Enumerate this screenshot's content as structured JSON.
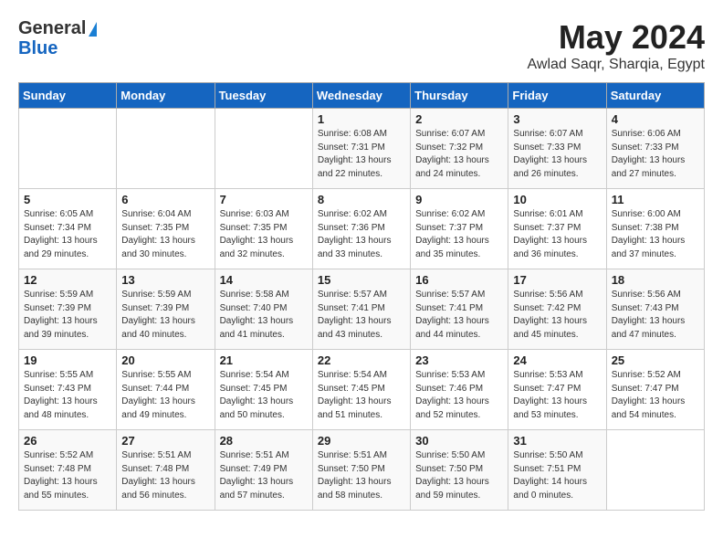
{
  "header": {
    "logo_line1": "General",
    "logo_line2": "Blue",
    "month": "May 2024",
    "location": "Awlad Saqr, Sharqia, Egypt"
  },
  "weekdays": [
    "Sunday",
    "Monday",
    "Tuesday",
    "Wednesday",
    "Thursday",
    "Friday",
    "Saturday"
  ],
  "weeks": [
    [
      {
        "day": "",
        "content": ""
      },
      {
        "day": "",
        "content": ""
      },
      {
        "day": "",
        "content": ""
      },
      {
        "day": "1",
        "content": "Sunrise: 6:08 AM\nSunset: 7:31 PM\nDaylight: 13 hours\nand 22 minutes."
      },
      {
        "day": "2",
        "content": "Sunrise: 6:07 AM\nSunset: 7:32 PM\nDaylight: 13 hours\nand 24 minutes."
      },
      {
        "day": "3",
        "content": "Sunrise: 6:07 AM\nSunset: 7:33 PM\nDaylight: 13 hours\nand 26 minutes."
      },
      {
        "day": "4",
        "content": "Sunrise: 6:06 AM\nSunset: 7:33 PM\nDaylight: 13 hours\nand 27 minutes."
      }
    ],
    [
      {
        "day": "5",
        "content": "Sunrise: 6:05 AM\nSunset: 7:34 PM\nDaylight: 13 hours\nand 29 minutes."
      },
      {
        "day": "6",
        "content": "Sunrise: 6:04 AM\nSunset: 7:35 PM\nDaylight: 13 hours\nand 30 minutes."
      },
      {
        "day": "7",
        "content": "Sunrise: 6:03 AM\nSunset: 7:35 PM\nDaylight: 13 hours\nand 32 minutes."
      },
      {
        "day": "8",
        "content": "Sunrise: 6:02 AM\nSunset: 7:36 PM\nDaylight: 13 hours\nand 33 minutes."
      },
      {
        "day": "9",
        "content": "Sunrise: 6:02 AM\nSunset: 7:37 PM\nDaylight: 13 hours\nand 35 minutes."
      },
      {
        "day": "10",
        "content": "Sunrise: 6:01 AM\nSunset: 7:37 PM\nDaylight: 13 hours\nand 36 minutes."
      },
      {
        "day": "11",
        "content": "Sunrise: 6:00 AM\nSunset: 7:38 PM\nDaylight: 13 hours\nand 37 minutes."
      }
    ],
    [
      {
        "day": "12",
        "content": "Sunrise: 5:59 AM\nSunset: 7:39 PM\nDaylight: 13 hours\nand 39 minutes."
      },
      {
        "day": "13",
        "content": "Sunrise: 5:59 AM\nSunset: 7:39 PM\nDaylight: 13 hours\nand 40 minutes."
      },
      {
        "day": "14",
        "content": "Sunrise: 5:58 AM\nSunset: 7:40 PM\nDaylight: 13 hours\nand 41 minutes."
      },
      {
        "day": "15",
        "content": "Sunrise: 5:57 AM\nSunset: 7:41 PM\nDaylight: 13 hours\nand 43 minutes."
      },
      {
        "day": "16",
        "content": "Sunrise: 5:57 AM\nSunset: 7:41 PM\nDaylight: 13 hours\nand 44 minutes."
      },
      {
        "day": "17",
        "content": "Sunrise: 5:56 AM\nSunset: 7:42 PM\nDaylight: 13 hours\nand 45 minutes."
      },
      {
        "day": "18",
        "content": "Sunrise: 5:56 AM\nSunset: 7:43 PM\nDaylight: 13 hours\nand 47 minutes."
      }
    ],
    [
      {
        "day": "19",
        "content": "Sunrise: 5:55 AM\nSunset: 7:43 PM\nDaylight: 13 hours\nand 48 minutes."
      },
      {
        "day": "20",
        "content": "Sunrise: 5:55 AM\nSunset: 7:44 PM\nDaylight: 13 hours\nand 49 minutes."
      },
      {
        "day": "21",
        "content": "Sunrise: 5:54 AM\nSunset: 7:45 PM\nDaylight: 13 hours\nand 50 minutes."
      },
      {
        "day": "22",
        "content": "Sunrise: 5:54 AM\nSunset: 7:45 PM\nDaylight: 13 hours\nand 51 minutes."
      },
      {
        "day": "23",
        "content": "Sunrise: 5:53 AM\nSunset: 7:46 PM\nDaylight: 13 hours\nand 52 minutes."
      },
      {
        "day": "24",
        "content": "Sunrise: 5:53 AM\nSunset: 7:47 PM\nDaylight: 13 hours\nand 53 minutes."
      },
      {
        "day": "25",
        "content": "Sunrise: 5:52 AM\nSunset: 7:47 PM\nDaylight: 13 hours\nand 54 minutes."
      }
    ],
    [
      {
        "day": "26",
        "content": "Sunrise: 5:52 AM\nSunset: 7:48 PM\nDaylight: 13 hours\nand 55 minutes."
      },
      {
        "day": "27",
        "content": "Sunrise: 5:51 AM\nSunset: 7:48 PM\nDaylight: 13 hours\nand 56 minutes."
      },
      {
        "day": "28",
        "content": "Sunrise: 5:51 AM\nSunset: 7:49 PM\nDaylight: 13 hours\nand 57 minutes."
      },
      {
        "day": "29",
        "content": "Sunrise: 5:51 AM\nSunset: 7:50 PM\nDaylight: 13 hours\nand 58 minutes."
      },
      {
        "day": "30",
        "content": "Sunrise: 5:50 AM\nSunset: 7:50 PM\nDaylight: 13 hours\nand 59 minutes."
      },
      {
        "day": "31",
        "content": "Sunrise: 5:50 AM\nSunset: 7:51 PM\nDaylight: 14 hours\nand 0 minutes."
      },
      {
        "day": "",
        "content": ""
      }
    ]
  ]
}
